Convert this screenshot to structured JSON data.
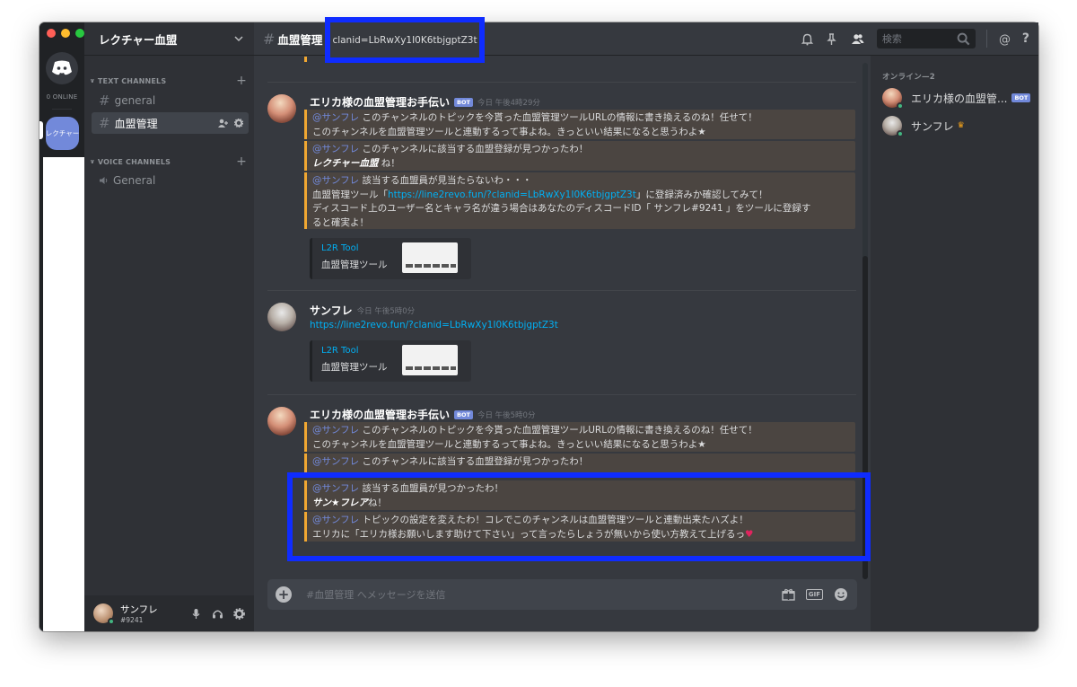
{
  "server": {
    "name": "レクチャー血盟",
    "guild_label": "レクチャー",
    "online_count": "0 ONLINE"
  },
  "categories": {
    "text": "TEXT CHANNELS",
    "voice": "VOICE CHANNELS"
  },
  "channels": [
    {
      "name": "general",
      "type": "text",
      "active": false
    },
    {
      "name": "血盟管理",
      "type": "text",
      "active": true
    },
    {
      "name": "General",
      "type": "voice",
      "active": false
    }
  ],
  "user": {
    "name": "サンフレ",
    "tag": "#9241"
  },
  "header": {
    "channel": "血盟管理",
    "topic": "clanid=LbRwXy1I0K6tbjgptZ3t",
    "search_placeholder": "検索"
  },
  "messages": [
    {
      "author": "エリカ様の血盟管理お手伝い",
      "bot_label": "BOT",
      "time": "今日 午後4時29分",
      "embeds": [
        {
          "mention": "@サンフレ",
          "line1": " このチャンネルのトピックを今貰った血盟管理ツールURLの情報に書き換えるのね！任せて！",
          "line2": "このチャンネルを血盟管理ツールと連動するって事よね。きっといい結果になると思うわよ★"
        },
        {
          "mention": "@サンフレ",
          "line1": " このチャンネルに該当する血盟登録が見つかったわ！",
          "emph": "レクチャー血盟",
          "line2_rest": " ね！"
        },
        {
          "mention": "@サンフレ",
          "line1": " 該当する血盟員が見当たらないわ・・・",
          "line2_pre": "血盟管理ツール「",
          "link": "https://line2revo.fun/?clanid=LbRwXy1I0K6tbjgptZ3t",
          "line2_post": "」に登録済みか確認してみて！",
          "line3": "ディスコード上のユーザー名とキャラ名が違う場合はあなたのディスコードID「 サンフレ#9241 」をツールに登録す",
          "line4": "ると確実よ！"
        }
      ],
      "card": {
        "title": "L2R Tool",
        "desc": "血盟管理ツール"
      }
    },
    {
      "author": "サンフレ",
      "time": "今日 午後5時0分",
      "link": "https://line2revo.fun/?clanid=LbRwXy1I0K6tbjgptZ3t",
      "card": {
        "title": "L2R Tool",
        "desc": "血盟管理ツール"
      }
    },
    {
      "author": "エリカ様の血盟管理お手伝い",
      "bot_label": "BOT",
      "time": "今日 午後5時0分",
      "embeds": [
        {
          "mention": "@サンフレ",
          "line1": " このチャンネルのトピックを今貰った血盟管理ツールURLの情報に書き換えるのね！任せて！",
          "line2": "このチャンネルを血盟管理ツールと連動するって事よね。きっといい結果になると思うわよ★"
        },
        {
          "mention": "@サンフレ",
          "line1": " このチャンネルに該当する血盟登録が見つかったわ！"
        },
        {
          "mention": "@サンフレ",
          "line1": " 該当する血盟員が見つかったわ！",
          "emph": "サン★フレア",
          "line2_rest": "ね！"
        },
        {
          "mention": "@サンフレ",
          "line1": " トピックの設定を変えたわ！コレでこのチャンネルは血盟管理ツールと連動出来たハズよ！",
          "line2": "エリカに「エリカ様お願いします助けて下さい」って言ったらしょうが無いから使い方教えて上げるっ",
          "heart": "♥"
        }
      ]
    }
  ],
  "input": {
    "placeholder": "#血盟管理 へメッセージを送信"
  },
  "members": {
    "header": "オンライン—2",
    "list": [
      {
        "name": "エリカ様の血盟管...",
        "badge": "BOT"
      },
      {
        "name": "サンフレ",
        "owner_icon": "crown-icon"
      }
    ]
  },
  "colors": {
    "highlight": "#0f2cff",
    "embed_border": "#f0a732",
    "mention": "#7289da",
    "link": "#00b0f4",
    "online": "#43b581"
  }
}
